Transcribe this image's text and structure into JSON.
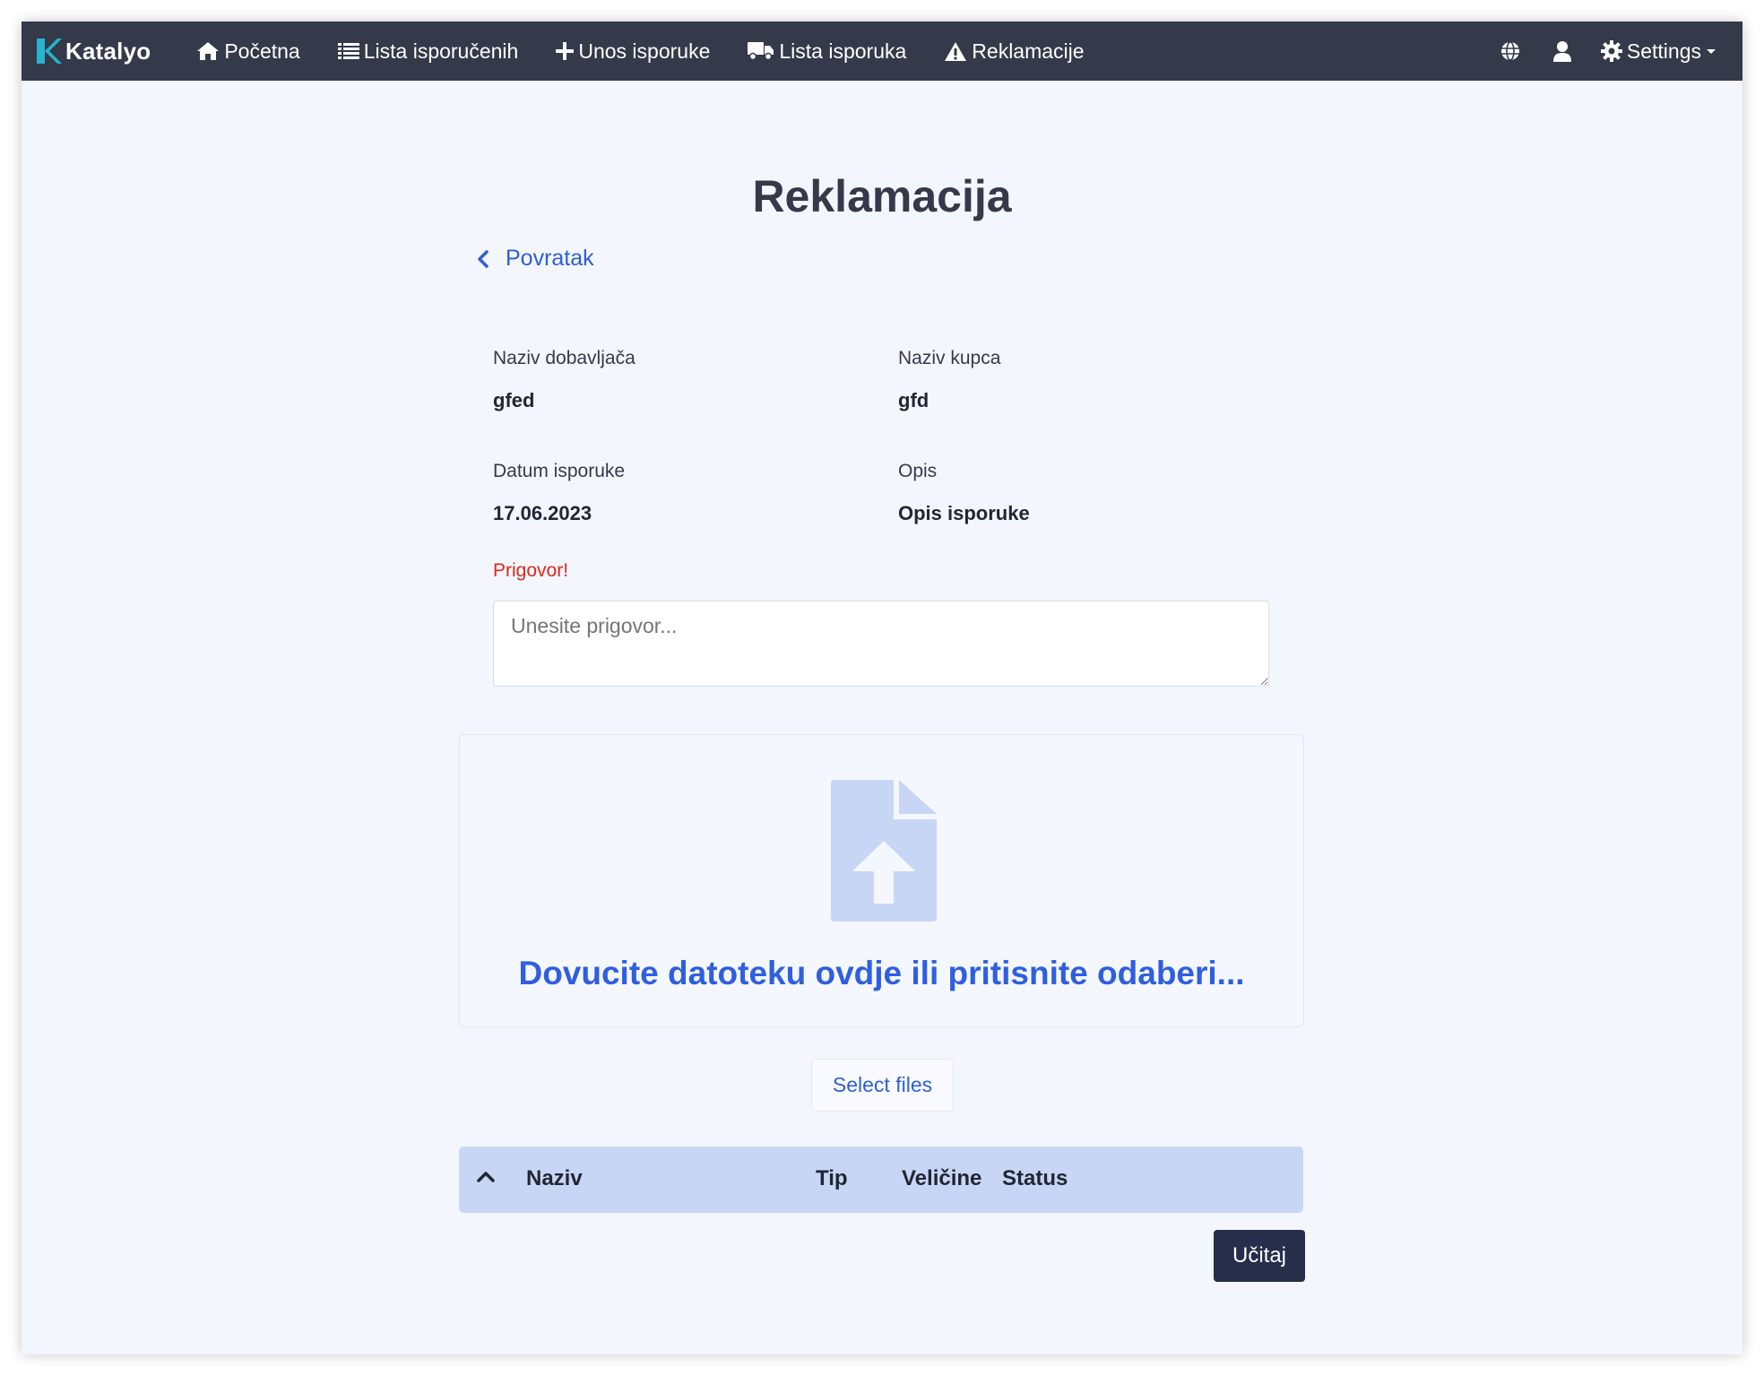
{
  "navbar": {
    "brand": "Katalyo",
    "items": [
      {
        "label": "Početna",
        "icon": "home-icon"
      },
      {
        "label": "Lista isporučenih",
        "icon": "list-icon"
      },
      {
        "label": "Unos isporuke",
        "icon": "plus-icon"
      },
      {
        "label": "Lista isporuka",
        "icon": "truck-icon"
      },
      {
        "label": "Reklamacije",
        "icon": "warning-icon"
      }
    ],
    "right": {
      "language_icon": "globe-icon",
      "user_icon": "user-icon",
      "settings_label": "Settings",
      "settings_icon": "gear-icon"
    }
  },
  "page": {
    "title": "Reklamacija",
    "back_label": "Povratak"
  },
  "details": {
    "supplier_label": "Naziv dobavljača",
    "supplier_value": "gfed",
    "customer_label": "Naziv kupca",
    "customer_value": "gfd",
    "date_label": "Datum isporuke",
    "date_value": "17.06.2023",
    "description_label": "Opis",
    "description_value": "Opis isporuke"
  },
  "complaint": {
    "label": "Prigovor!",
    "placeholder": "Unesite prigovor...",
    "value": ""
  },
  "upload": {
    "dropzone_text": "Dovucite datoteku ovdje ili pritisnite odaberi...",
    "select_label": "Select files",
    "table_columns": [
      "Naziv",
      "Tip",
      "Veličine",
      "Status"
    ],
    "submit_label": "Učitaj"
  },
  "colors": {
    "navbar": "#343a4a",
    "background": "#f3f6fd",
    "accent": "#2f5fd4",
    "error": "#e1261c",
    "table_header": "#c8d6f6",
    "primary_button": "#262e4b"
  }
}
